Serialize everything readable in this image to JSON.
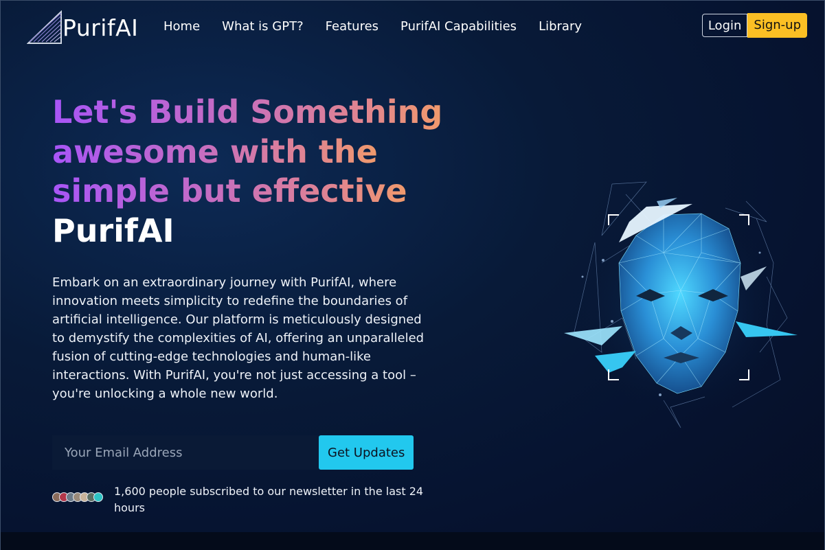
{
  "brand": {
    "name": "PurifAI",
    "logo_icon": "triangle-logo-icon"
  },
  "nav": {
    "links": [
      "Home",
      "What is GPT?",
      "Features",
      "PurifAI Capabilities",
      "Library"
    ],
    "login_label": "Login",
    "signup_label": "Sign-up"
  },
  "hero": {
    "title_lines": [
      "Let's Build Something",
      "awesome with the",
      "simple but effective"
    ],
    "title_brand": "PurifAI",
    "description": "Embark on an extraordinary journey with PurifAI, where innovation meets simplicity to redefine the boundaries of artificial intelligence. Our platform is meticulously designed to demystify the complexities of AI, offering an unparalleled fusion of cutting-edge technologies and human-like interactions. With PurifAI, you're not just accessing a tool – you're unlocking a whole new world.",
    "email_placeholder": "Your Email Address",
    "email_value": "",
    "cta_label": "Get Updates",
    "social_proof": "1,600 people subscribed to our newsletter in the last 24 hours",
    "illustration": "polygonal-ai-face-illustration"
  },
  "colors": {
    "accent_cyan": "#22c8ee",
    "accent_yellow": "#fbbf24",
    "gradient_start": "#a855f7",
    "gradient_end": "#f09a6c",
    "background": "#081a38"
  }
}
